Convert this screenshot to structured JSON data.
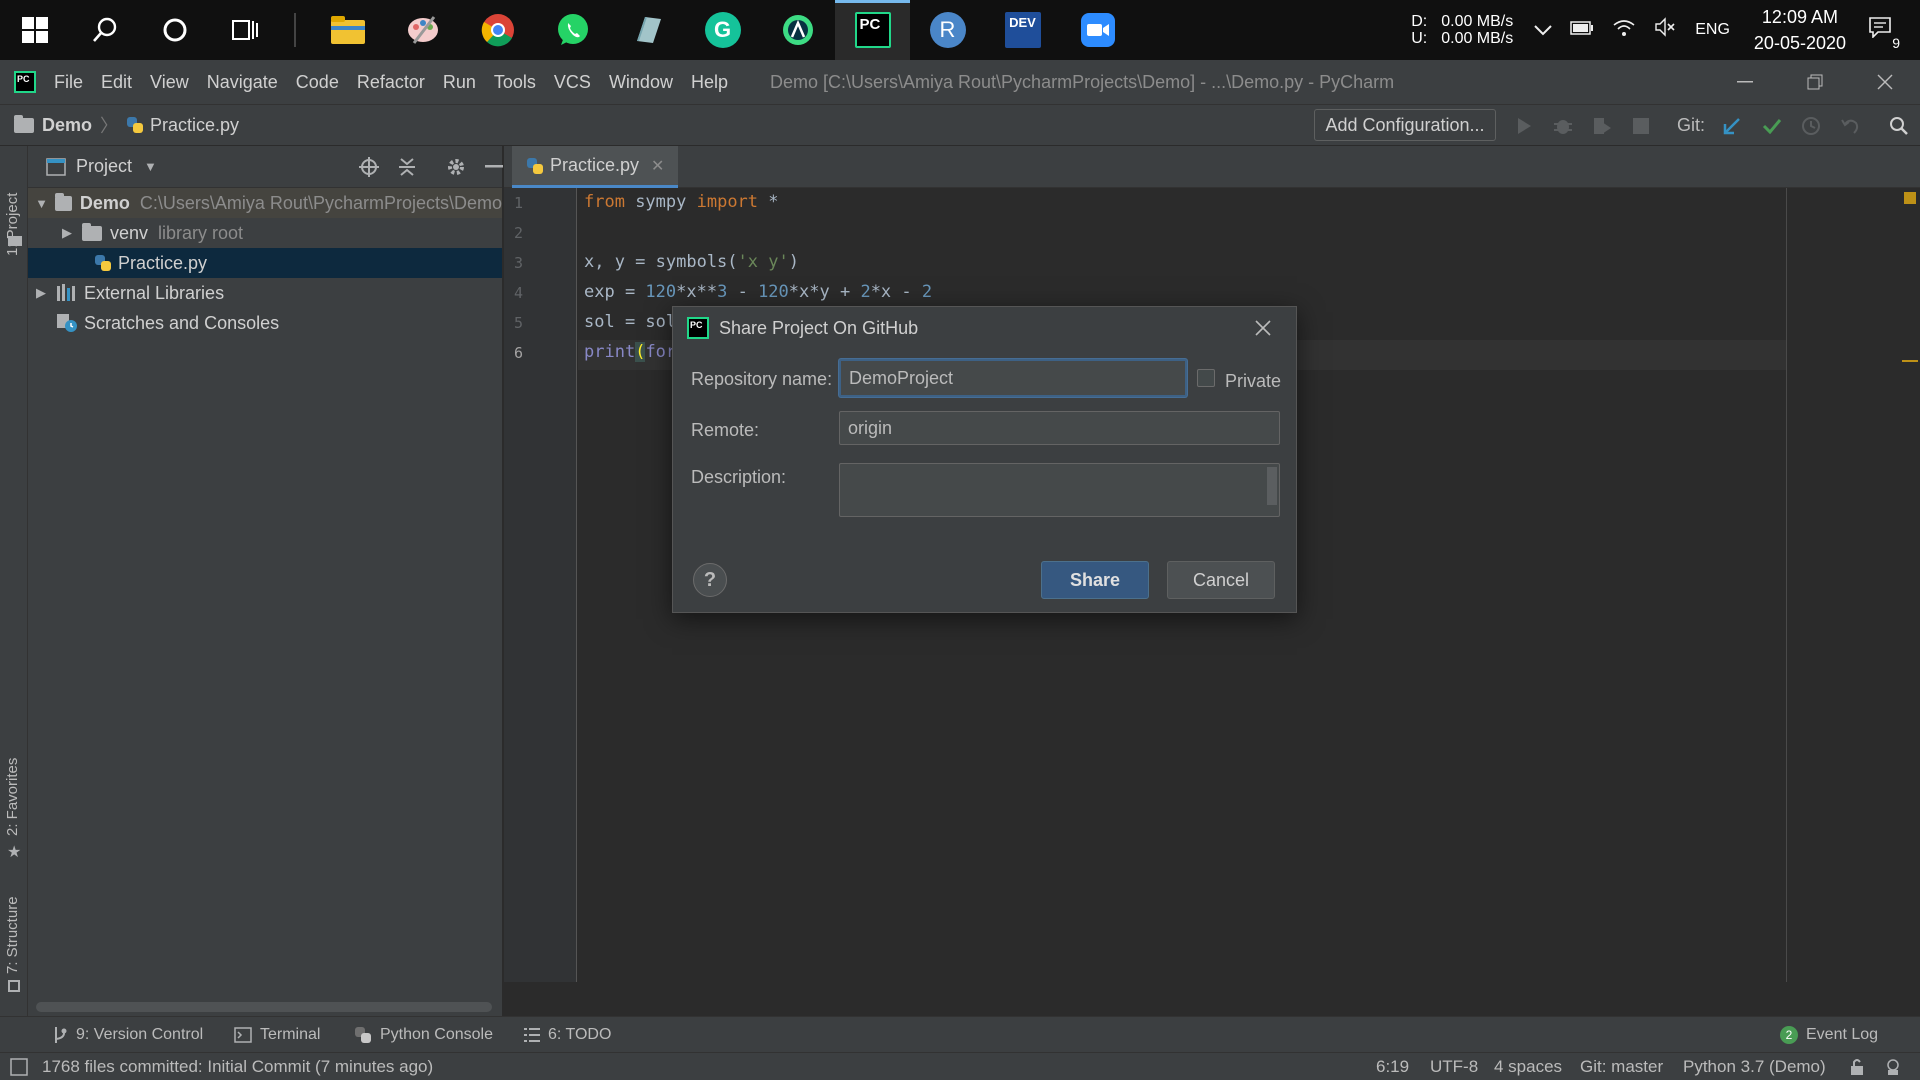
{
  "taskbar": {
    "apps": [
      {
        "name": "file-explorer",
        "color": "#f1c232"
      },
      {
        "name": "paint",
        "color": "#e06666"
      },
      {
        "name": "chrome",
        "color": "#4285f4"
      },
      {
        "name": "whatsapp",
        "color": "#25d366"
      },
      {
        "name": "notepad",
        "color": "#76a5af"
      },
      {
        "name": "grammarly",
        "color": "#15c39a",
        "label": "G"
      },
      {
        "name": "android-studio",
        "color": "#3ddc84"
      },
      {
        "name": "pycharm",
        "color": "#000000",
        "label": "PC"
      },
      {
        "name": "r-app",
        "color": "#4a86c8",
        "label": "R"
      },
      {
        "name": "dev-cpp",
        "color": "#1f4e9a",
        "label": "DEV"
      },
      {
        "name": "zoom",
        "color": "#2d8cff"
      }
    ],
    "net_labels": [
      "D:",
      "U:"
    ],
    "net_rates": [
      "0.00 MB/s",
      "0.00 MB/s"
    ],
    "language": "ENG",
    "time": "12:09 AM",
    "date": "20-05-2020",
    "notification_count": "9"
  },
  "menubar": {
    "items": [
      "File",
      "Edit",
      "View",
      "Navigate",
      "Code",
      "Refactor",
      "Run",
      "Tools",
      "VCS",
      "Window",
      "Help"
    ],
    "window_title": "Demo [C:\\Users\\Amiya Rout\\PycharmProjects\\Demo] - ...\\Demo.py - PyCharm"
  },
  "navbar": {
    "project": "Demo",
    "file": "Practice.py",
    "add_configuration": "Add Configuration...",
    "git_label": "Git:"
  },
  "left_stripe": {
    "project_tab": "1: Project",
    "favorites_tab": "2: Favorites",
    "structure_tab": "7: Structure"
  },
  "project_panel": {
    "title": "Project",
    "tree": [
      {
        "label": "Demo",
        "detail": "C:\\Users\\Amiya Rout\\PycharmProjects\\Demo"
      },
      {
        "label": "venv",
        "detail": "library root"
      },
      {
        "label": "Practice.py",
        "detail": ""
      },
      {
        "label": "External Libraries",
        "detail": ""
      },
      {
        "label": "Scratches and Consoles",
        "detail": ""
      }
    ]
  },
  "editor": {
    "tab": "Practice.py",
    "line_numbers": [
      "1",
      "2",
      "3",
      "4",
      "5",
      "6"
    ],
    "code": {
      "l1_from": "from",
      "l1_mod": " sympy ",
      "l1_import": "import",
      "l1_star": " *",
      "l3_a": "x, y = symbols(",
      "l3_str": "'x y'",
      "l3_b": ")",
      "l4_a": "exp = ",
      "l4_n1": "120",
      "l4_b": "*x**",
      "l4_n2": "3",
      "l4_c": " - ",
      "l4_n3": "120",
      "l4_d": "*x*y + ",
      "l4_n4": "2",
      "l4_e": "*x - ",
      "l4_n5": "2",
      "l5": "sol = sol",
      "l6_print": "print",
      "l6_paren": "(",
      "l6_rest": "for"
    }
  },
  "dialog": {
    "title": "Share Project On GitHub",
    "repo_label": "Repository name:",
    "repo_value": "DemoProject",
    "private_label": "Private",
    "remote_label": "Remote:",
    "remote_value": "origin",
    "description_label": "Description:",
    "description_value": "",
    "help": "?",
    "share": "Share",
    "cancel": "Cancel"
  },
  "bottom_tools": {
    "version_control": "9: Version Control",
    "terminal": "Terminal",
    "python_console": "Python Console",
    "todo": "6: TODO",
    "event_log": "Event Log",
    "event_count": "2"
  },
  "statusbar": {
    "message": "1768 files committed: Initial Commit (7 minutes ago)",
    "position": "6:19",
    "encoding": "UTF-8",
    "indent": "4 spaces",
    "git_branch": "Git: master",
    "interpreter": "Python 3.7 (Demo)"
  }
}
